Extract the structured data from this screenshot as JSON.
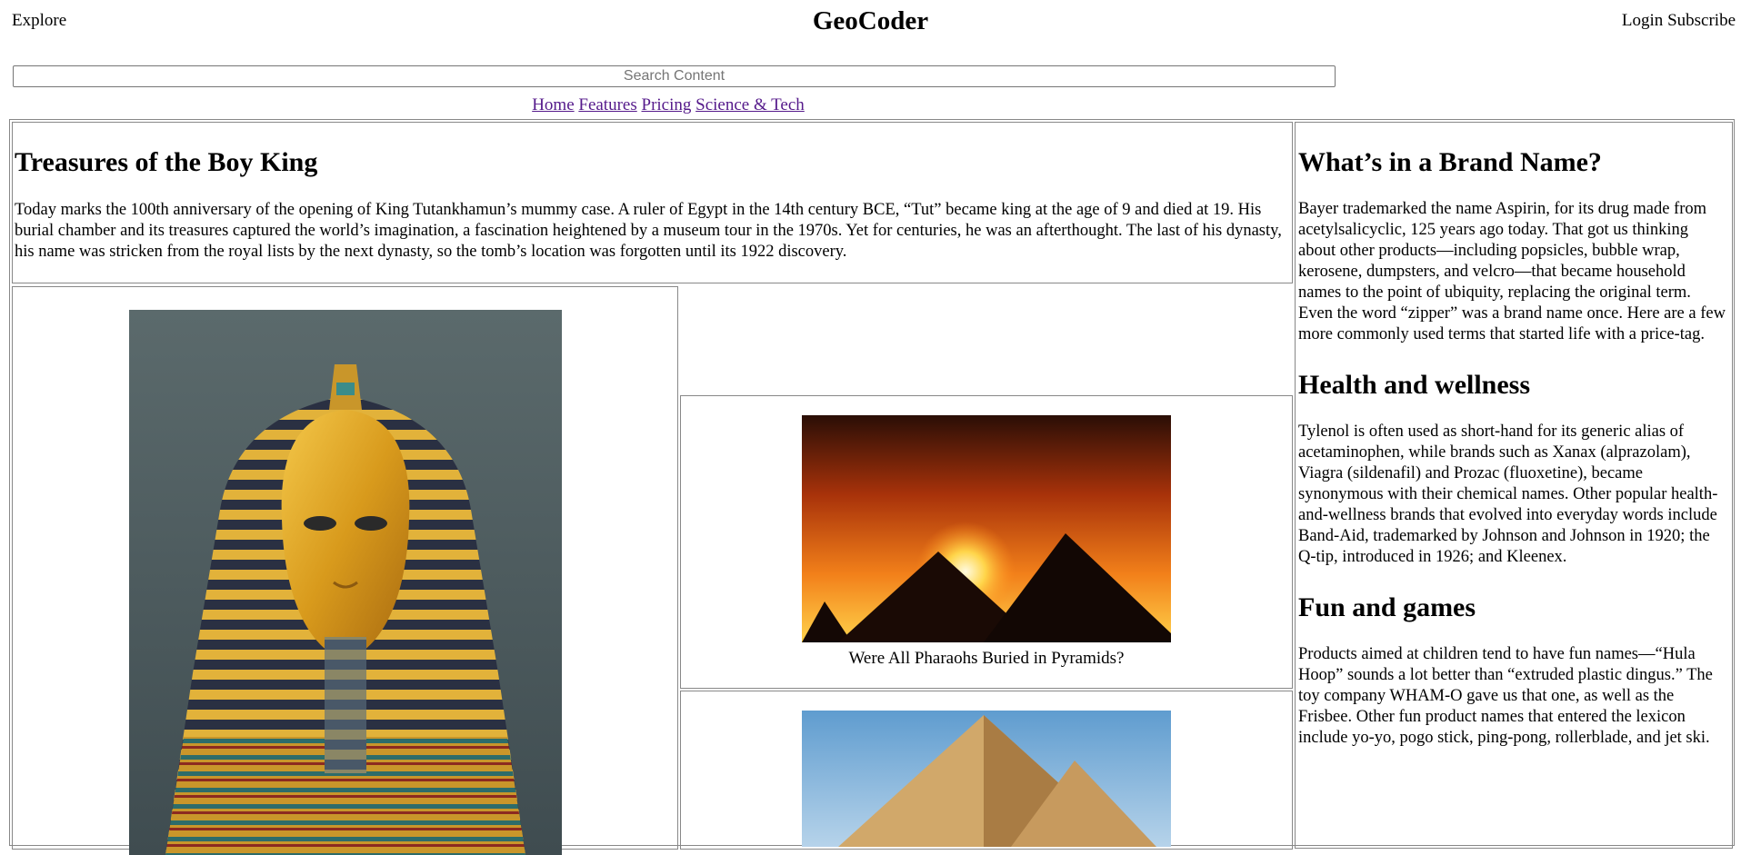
{
  "header": {
    "explore_label": "Explore",
    "brand": "GeoCoder",
    "login_label": "Login",
    "subscribe_label": "Subscribe"
  },
  "search": {
    "placeholder": "Search Content",
    "value": ""
  },
  "nav": {
    "items": [
      {
        "label": "Home"
      },
      {
        "label": "Features"
      },
      {
        "label": "Pricing"
      },
      {
        "label": "Science & Tech"
      }
    ]
  },
  "main_article": {
    "title": "Treasures of the Boy King",
    "body": "Today marks the 100th anniversary of the opening of King Tutankhamun’s mummy case. A ruler of Egypt in the 14th century BCE, “Tut” became king at the age of 9 and died at 19. His burial chamber and its treasures captured the world’s imagination, a fascination heightened by a museum tour in the 1970s. Yet for centuries, he was an afterthought. The last of his dynasty, his name was stricken from the royal lists by the next dynasty, so the tomb’s location was forgotten until its 1922 discovery."
  },
  "feature_cards": [
    {
      "caption": "Were All Pharaohs Buried in Pyramids?"
    }
  ],
  "sidebar": {
    "sections": [
      {
        "title": "What’s in a Brand Name?",
        "body": "Bayer trademarked the name Aspirin, for its drug made from acetylsalicyclic, 125 years ago today. That got us thinking about other products—including popsicles, bubble wrap, kerosene, dumpsters, and velcro—that became household names to the point of ubiquity, replacing the original term. Even the word “zipper” was a brand name once. Here are a few more commonly used terms that started life with a price-tag."
      },
      {
        "title": "Health and wellness",
        "body": "Tylenol is often used as short-hand for its generic alias of acetaminophen, while brands such as Xanax (alprazolam), Viagra (sildenafil) and Prozac (fluoxetine), became synonymous with their chemical names. Other popular health-and-wellness brands that evolved into everyday words include Band-Aid, trademarked by Johnson and Johnson in 1920; the Q-tip, introduced in 1926; and Kleenex."
      },
      {
        "title": "Fun and games",
        "body": "Products aimed at children tend to have fun names—“Hula Hoop” sounds a lot better than “extruded plastic dingus.” The toy company WHAM-O gave us that one, as well as the Frisbee. Other fun product names that entered the lexicon include yo-yo, pogo stick, ping-pong, rollerblade, and jet ski."
      }
    ]
  }
}
